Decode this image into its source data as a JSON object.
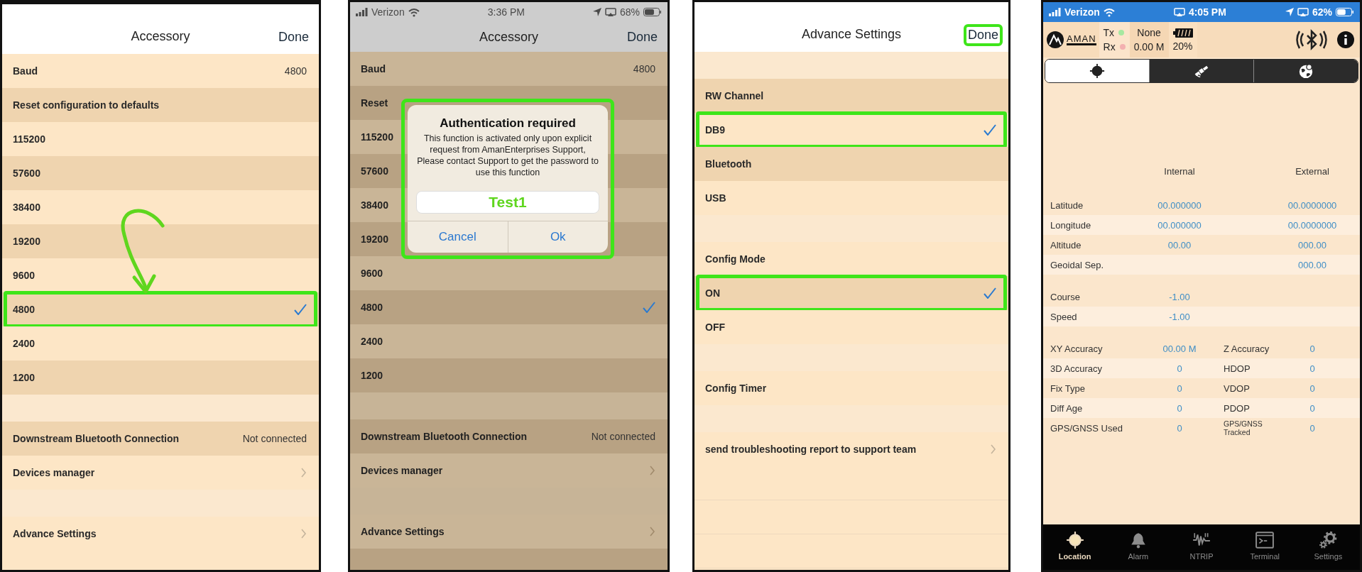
{
  "panels": [
    {
      "kind": "settings",
      "dimmed": false,
      "title": "Accessory",
      "done": {
        "label": "Done",
        "highlighted": false
      },
      "annotation_arrow": true,
      "rows": [
        {
          "kind": "value",
          "label": "Baud",
          "value": "4800"
        },
        {
          "kind": "plain",
          "label": "Reset configuration to defaults"
        },
        {
          "kind": "option",
          "label": "115200",
          "checked": false,
          "highlighted": false
        },
        {
          "kind": "option",
          "label": "57600",
          "checked": false,
          "highlighted": false
        },
        {
          "kind": "option",
          "label": "38400",
          "checked": false,
          "highlighted": false
        },
        {
          "kind": "option",
          "label": "19200",
          "checked": false,
          "highlighted": false
        },
        {
          "kind": "option",
          "label": "9600",
          "checked": false,
          "highlighted": false
        },
        {
          "kind": "option",
          "label": "4800",
          "checked": true,
          "highlighted": true
        },
        {
          "kind": "option",
          "label": "2400",
          "checked": false,
          "highlighted": false
        },
        {
          "kind": "option",
          "label": "1200",
          "checked": false,
          "highlighted": false
        },
        {
          "kind": "spacer"
        },
        {
          "kind": "value",
          "label": "Downstream Bluetooth Connection",
          "value": "Not connected"
        },
        {
          "kind": "link",
          "label": "Devices manager"
        },
        {
          "kind": "spacer"
        },
        {
          "kind": "link",
          "label": "Advance Settings"
        }
      ]
    },
    {
      "kind": "settings",
      "dimmed": true,
      "status_bar": {
        "carrier": "Verizon",
        "time": "3:36 PM",
        "battery": "68%"
      },
      "title": "Accessory",
      "done": {
        "label": "Done",
        "highlighted": false
      },
      "annotation_arrow": false,
      "rows": [
        {
          "kind": "value",
          "label": "Baud",
          "value": "4800"
        },
        {
          "kind": "plain",
          "label": "Reset"
        },
        {
          "kind": "option",
          "label": "115200",
          "checked": false,
          "highlighted": false
        },
        {
          "kind": "option",
          "label": "57600",
          "checked": false,
          "highlighted": false
        },
        {
          "kind": "option",
          "label": "38400",
          "checked": false,
          "highlighted": false
        },
        {
          "kind": "option",
          "label": "19200",
          "checked": false,
          "highlighted": false
        },
        {
          "kind": "option",
          "label": "9600",
          "checked": false,
          "highlighted": false
        },
        {
          "kind": "option",
          "label": "4800",
          "checked": true,
          "highlighted": false
        },
        {
          "kind": "option",
          "label": "2400",
          "checked": false,
          "highlighted": false
        },
        {
          "kind": "option",
          "label": "1200",
          "checked": false,
          "highlighted": false
        },
        {
          "kind": "spacer"
        },
        {
          "kind": "value",
          "label": "Downstream Bluetooth Connection",
          "value": "Not connected"
        },
        {
          "kind": "link",
          "label": "Devices manager"
        },
        {
          "kind": "spacer"
        },
        {
          "kind": "link",
          "label": "Advance Settings"
        }
      ],
      "dialog": {
        "title": "Authentication required",
        "message": "This function is activated only upon explicit request from AmanEnterprises Support, Please contact Support to get the password to use this function",
        "field_value": "Test1",
        "buttons": [
          "Cancel",
          "Ok"
        ],
        "highlighted": true
      }
    },
    {
      "kind": "settings",
      "dimmed": false,
      "title": "Advance Settings",
      "done": {
        "label": "Done",
        "highlighted": true
      },
      "annotation_arrow": false,
      "rows": [
        {
          "kind": "spacer"
        },
        {
          "kind": "plain",
          "label": "RW Channel"
        },
        {
          "kind": "option",
          "label": "DB9",
          "checked": true,
          "highlighted": true
        },
        {
          "kind": "option",
          "label": "Bluetooth",
          "checked": false,
          "highlighted": false
        },
        {
          "kind": "option",
          "label": "USB",
          "checked": false,
          "highlighted": false
        },
        {
          "kind": "spacer"
        },
        {
          "kind": "plain",
          "label": "Config Mode"
        },
        {
          "kind": "option",
          "label": "ON",
          "checked": true,
          "highlighted": true
        },
        {
          "kind": "option",
          "label": "OFF",
          "checked": false,
          "highlighted": false
        },
        {
          "kind": "spacer"
        },
        {
          "kind": "plain",
          "label": "Config Timer"
        },
        {
          "kind": "spacer"
        },
        {
          "kind": "link",
          "label": "send troubleshooting report to support team"
        }
      ]
    },
    {
      "kind": "gps",
      "status_bar": {
        "carrier": "Verizon",
        "time": "4:05 PM",
        "battery": "62%"
      },
      "header": {
        "logo_text": "AMAN",
        "indicators": [
          {
            "label": "Tx",
            "color": "#a6e8a0"
          },
          {
            "label": "Rx",
            "color": "#f3b0b0"
          }
        ],
        "mode": "None",
        "distance": "0.00 M",
        "battery": "20%"
      },
      "segments": [
        {
          "kind": "crosshair",
          "selected": true
        },
        {
          "kind": "satellite",
          "selected": false
        },
        {
          "kind": "globe",
          "selected": false
        }
      ],
      "columns": [
        "Internal",
        "External"
      ],
      "groups": [
        [
          {
            "kind": "measure",
            "label": "Latitude",
            "internal": "00.000000",
            "external": "00.0000000"
          },
          {
            "kind": "measure",
            "label": "Longitude",
            "internal": "00.000000",
            "external": "00.0000000"
          },
          {
            "kind": "measure",
            "label": "Altitude",
            "internal": "00.00",
            "external": "000.00"
          },
          {
            "kind": "measure",
            "label": "Geoidal Sep.",
            "external": "000.00"
          }
        ],
        [
          {
            "kind": "measure",
            "label": "Course",
            "internal": "-1.00"
          },
          {
            "kind": "measure",
            "label": "Speed",
            "internal": "-1.00"
          }
        ],
        [
          {
            "kind": "pair",
            "label": "XY Accuracy",
            "value": "00.00 M",
            "label_2": "Z Accuracy",
            "value_2": "0"
          },
          {
            "kind": "pair",
            "label": "3D Accuracy",
            "value": "0",
            "label_2": "HDOP",
            "value_2": "0"
          },
          {
            "kind": "pair",
            "label": "Fix Type",
            "value": "0",
            "label_2": "VDOP",
            "value_2": "0"
          },
          {
            "kind": "pair",
            "label": "Diff Age",
            "value": "0",
            "label_2": "PDOP",
            "value_2": "0"
          },
          {
            "kind": "pair",
            "label": "GPS/GNSS Used",
            "value": "0",
            "label_2": "GPS/GNSS Tracked",
            "value_2": "0"
          }
        ]
      ],
      "tabs": [
        {
          "kind": "crosshair",
          "label": "Location",
          "selected": true
        },
        {
          "kind": "bell",
          "label": "Alarm",
          "selected": false
        },
        {
          "kind": "wave",
          "label": "NTRIP",
          "selected": false
        },
        {
          "kind": "terminal",
          "label": "Terminal",
          "selected": false
        },
        {
          "kind": "gears",
          "label": "Settings",
          "selected": false
        }
      ]
    }
  ]
}
